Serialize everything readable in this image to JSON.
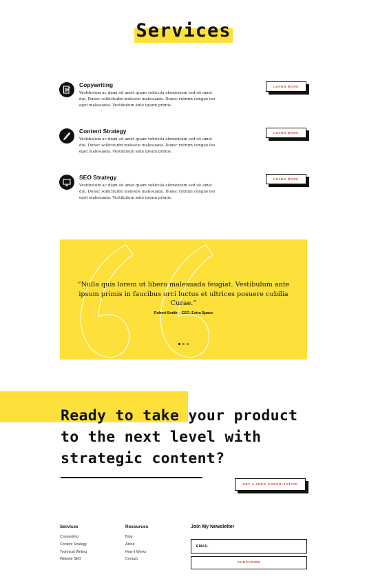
{
  "services": {
    "title": "Services",
    "items": [
      {
        "name": "Copywriting",
        "description": "Vestibulum ac diam sit amet quam vehicula elementum sed sit amet dui. Donec sollicitudin molestie malesuada. Donec rutrum congue leo eget malesuada. Vestibulum ante ipsum primis.",
        "button": "LEARN MORE",
        "icon": "document-icon"
      },
      {
        "name": "Content Strategy",
        "description": "Vestibulum ac diam sit amet quam vehicula elementum sed sit amet dui. Donec sollicitudin molestie malesuada. Donec rutrum congue leo eget malesuada. Vestibulum ante ipsum primis.",
        "button": "LEARN MORE",
        "icon": "pen-icon"
      },
      {
        "name": "SEO Strategy",
        "description": "Vestibulum ac diam sit amet quam vehicula elementum sed sit amet dui. Donec sollicitudin molestie malesuada. Donec rutrum congue leo eget malesuada. Vestibulum ante ipsum primis.",
        "button": "LEARN MORE",
        "icon": "monitor-icon"
      }
    ]
  },
  "testimonial": {
    "quote": "“Nulla quis lorem ut libero malesuada feugiat. Vestibulum ante ipsum primis in faucibus orci luctus et ultrices posuere cubilia Curae.”",
    "author": "Robert Smith – CEO, Extra Space",
    "slide_count": 3,
    "active_slide": 1
  },
  "cta": {
    "heading": "Ready to take your product to the next level with strategic content?",
    "button": "GET A FREE CONSULTATION"
  },
  "footer": {
    "services": {
      "heading": "Services",
      "links": [
        "Copywriting",
        "Content Strategy",
        "Technical Writing",
        "Website SEO"
      ]
    },
    "resources": {
      "heading": "Resources",
      "links": [
        "Blog",
        "About",
        "How it Works",
        "Contact"
      ]
    },
    "newsletter": {
      "heading": "Join My Newsletter",
      "email_placeholder": "EMAIL",
      "button": "SUBSCRIBE"
    }
  },
  "colors": {
    "accent_yellow": "#fde13a",
    "button_text": "#e2442f",
    "ink": "#111111"
  }
}
